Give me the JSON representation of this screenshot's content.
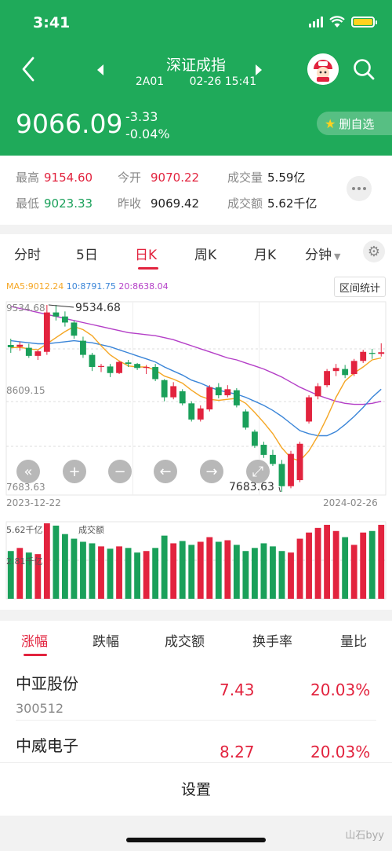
{
  "status": {
    "time": "3:41"
  },
  "header": {
    "title": "深证成指",
    "code": "2A01",
    "datetime": "02-26 15:41",
    "price": "9066.09",
    "change": "-3.33",
    "change_pct": "-0.04%",
    "watch_label": "删自选"
  },
  "stats": {
    "high_label": "最高",
    "high": "9154.60",
    "open_label": "今开",
    "open": "9070.22",
    "volume_label": "成交量",
    "volume": "5.59亿",
    "low_label": "最低",
    "low": "9023.33",
    "prev_label": "昨收",
    "prev": "9069.42",
    "amount_label": "成交额",
    "amount": "5.62千亿"
  },
  "tabs": [
    "分时",
    "5日",
    "日K",
    "周K",
    "月K",
    "分钟"
  ],
  "chart": {
    "ma5": "MA5:9012.24",
    "ma10": "10:8791.75",
    "ma20": "20:8638.04",
    "range_btn": "区间统计",
    "y_top": "9534.68",
    "y_mid": "8609.15",
    "y_bot": "7683.63",
    "hi_label": "9534.68",
    "lo_label": "7683.63",
    "date_start": "2023-12-22",
    "date_end": "2024-02-26",
    "vol_max": "5.62千亿",
    "vol_title": "成交额",
    "vol_half": "2.81千亿",
    "colors": {
      "up": "#e2233e",
      "down": "#1aa05a",
      "ma5": "#f5a623",
      "ma10": "#3a85d8",
      "ma20": "#b43fc7"
    }
  },
  "chart_data": {
    "type": "candlestick",
    "ylim": [
      7683.63,
      9534.68
    ],
    "candles": [
      {
        "o": 9138,
        "h": 9200,
        "l": 9060,
        "c": 9115
      },
      {
        "o": 9120,
        "h": 9170,
        "l": 9080,
        "c": 9140
      },
      {
        "o": 9110,
        "h": 9150,
        "l": 9010,
        "c": 9030
      },
      {
        "o": 9030,
        "h": 9090,
        "l": 8990,
        "c": 9075
      },
      {
        "o": 9070,
        "h": 9534.68,
        "l": 9040,
        "c": 9460
      },
      {
        "o": 9460,
        "h": 9534.68,
        "l": 9380,
        "c": 9420
      },
      {
        "o": 9420,
        "h": 9470,
        "l": 9320,
        "c": 9360
      },
      {
        "o": 9360,
        "h": 9380,
        "l": 9200,
        "c": 9230
      },
      {
        "o": 9180,
        "h": 9220,
        "l": 9010,
        "c": 9040
      },
      {
        "o": 9040,
        "h": 9060,
        "l": 8880,
        "c": 8920
      },
      {
        "o": 8920,
        "h": 8950,
        "l": 8870,
        "c": 8930
      },
      {
        "o": 8925,
        "h": 8950,
        "l": 8820,
        "c": 8860
      },
      {
        "o": 8860,
        "h": 8980,
        "l": 8850,
        "c": 8970
      },
      {
        "o": 8965,
        "h": 8990,
        "l": 8920,
        "c": 8950
      },
      {
        "o": 8950,
        "h": 8960,
        "l": 8890,
        "c": 8910
      },
      {
        "o": 8915,
        "h": 8940,
        "l": 8850,
        "c": 8920
      },
      {
        "o": 8920,
        "h": 8950,
        "l": 8780,
        "c": 8800
      },
      {
        "o": 8790,
        "h": 8800,
        "l": 8580,
        "c": 8620
      },
      {
        "o": 8620,
        "h": 8770,
        "l": 8600,
        "c": 8730
      },
      {
        "o": 8680,
        "h": 8700,
        "l": 8540,
        "c": 8560
      },
      {
        "o": 8560,
        "h": 8580,
        "l": 8380,
        "c": 8400
      },
      {
        "o": 8400,
        "h": 8540,
        "l": 8380,
        "c": 8510
      },
      {
        "o": 8500,
        "h": 8740,
        "l": 8480,
        "c": 8720
      },
      {
        "o": 8720,
        "h": 8760,
        "l": 8610,
        "c": 8640
      },
      {
        "o": 8640,
        "h": 8740,
        "l": 8620,
        "c": 8700
      },
      {
        "o": 8690,
        "h": 8710,
        "l": 8520,
        "c": 8540
      },
      {
        "o": 8480,
        "h": 8500,
        "l": 8300,
        "c": 8320
      },
      {
        "o": 8280,
        "h": 8300,
        "l": 8120,
        "c": 8140
      },
      {
        "o": 8150,
        "h": 8180,
        "l": 8020,
        "c": 8050
      },
      {
        "o": 8050,
        "h": 8100,
        "l": 7940,
        "c": 7960
      },
      {
        "o": 7960,
        "h": 8000,
        "l": 7683.63,
        "c": 7740
      },
      {
        "o": 7740,
        "h": 8090,
        "l": 7720,
        "c": 8060
      },
      {
        "o": 7800,
        "h": 8180,
        "l": 7780,
        "c": 8160
      },
      {
        "o": 8380,
        "h": 8640,
        "l": 8360,
        "c": 8620
      },
      {
        "o": 8630,
        "h": 8760,
        "l": 8600,
        "c": 8730
      },
      {
        "o": 8740,
        "h": 8900,
        "l": 8720,
        "c": 8880
      },
      {
        "o": 8880,
        "h": 8950,
        "l": 8830,
        "c": 8910
      },
      {
        "o": 8900,
        "h": 8940,
        "l": 8810,
        "c": 8840
      },
      {
        "o": 8850,
        "h": 9000,
        "l": 8830,
        "c": 8980
      },
      {
        "o": 8980,
        "h": 9090,
        "l": 8960,
        "c": 9070
      },
      {
        "o": 9060,
        "h": 9100,
        "l": 9000,
        "c": 9050
      },
      {
        "o": 9050,
        "h": 9154.6,
        "l": 9023.33,
        "c": 9066
      }
    ],
    "ma5": [
      9110,
      9115,
      9100,
      9090,
      9150,
      9210,
      9270,
      9320,
      9290,
      9230,
      9130,
      9040,
      8980,
      8930,
      8920,
      8920,
      8890,
      8830,
      8800,
      8760,
      8690,
      8630,
      8600,
      8590,
      8600,
      8610,
      8560,
      8470,
      8370,
      8260,
      8120,
      8020,
      7990,
      8090,
      8240,
      8420,
      8620,
      8780,
      8860,
      8920,
      8990,
      9010
    ],
    "ma10": [
      9180,
      9170,
      9160,
      9150,
      9150,
      9160,
      9170,
      9180,
      9170,
      9160,
      9140,
      9120,
      9090,
      9060,
      9030,
      9000,
      8970,
      8920,
      8880,
      8840,
      8790,
      8760,
      8720,
      8690,
      8670,
      8650,
      8620,
      8580,
      8540,
      8490,
      8430,
      8360,
      8290,
      8260,
      8240,
      8240,
      8280,
      8350,
      8430,
      8520,
      8620,
      8700
    ],
    "ma20": [
      9520,
      9500,
      9480,
      9460,
      9440,
      9420,
      9400,
      9380,
      9360,
      9340,
      9320,
      9300,
      9280,
      9260,
      9250,
      9240,
      9230,
      9210,
      9190,
      9160,
      9130,
      9100,
      9070,
      9040,
      9010,
      8990,
      8960,
      8930,
      8900,
      8860,
      8820,
      8770,
      8720,
      8680,
      8640,
      8610,
      8580,
      8560,
      8550,
      8550,
      8560,
      8580
    ],
    "volume_ratio": [
      0.62,
      0.66,
      0.6,
      0.58,
      0.98,
      0.95,
      0.84,
      0.78,
      0.74,
      0.72,
      0.68,
      0.65,
      0.68,
      0.66,
      0.6,
      0.62,
      0.66,
      0.82,
      0.72,
      0.75,
      0.7,
      0.74,
      0.8,
      0.74,
      0.76,
      0.7,
      0.62,
      0.66,
      0.72,
      0.68,
      0.62,
      0.6,
      0.78,
      0.86,
      0.92,
      0.96,
      0.88,
      0.8,
      0.7,
      0.86,
      0.88,
      0.96
    ],
    "x_start": "2023-12-22",
    "x_end": "2024-02-26"
  },
  "bottom_tabs": [
    "涨幅",
    "跌幅",
    "成交额",
    "换手率",
    "量比"
  ],
  "stocks": [
    {
      "name": "中亚股份",
      "code": "300512",
      "price": "7.43",
      "pct": "20.03%"
    },
    {
      "name": "中威电子",
      "code": "",
      "price": "8.27",
      "pct": "20.03%"
    }
  ],
  "settings_label": "设置",
  "watermark": "山石byy"
}
